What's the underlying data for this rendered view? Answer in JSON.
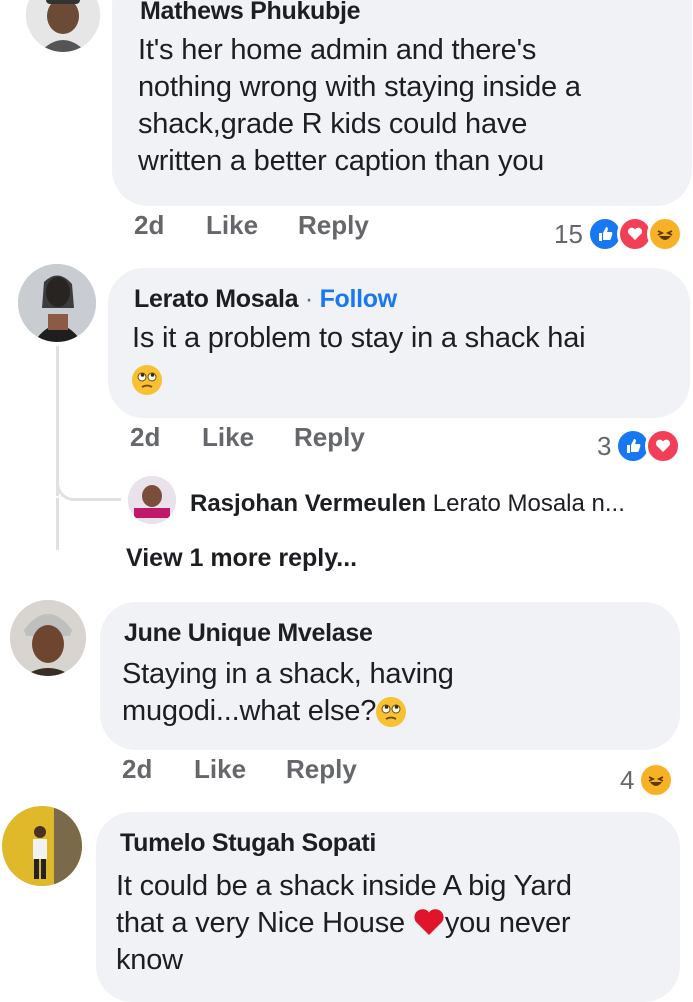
{
  "comments": [
    {
      "author": "Mathews Phukubje",
      "text_lines": [
        "It's her home admin and there's",
        "nothing wrong with staying inside a",
        "shack,grade R kids could have",
        "written a better caption than you"
      ],
      "time": "2d",
      "like": "Like",
      "reply": "Reply",
      "reaction_count": "15",
      "reactions": [
        "like-icon",
        "love-icon",
        "haha-icon"
      ]
    },
    {
      "author": "Lerato Mosala",
      "separator": "·",
      "follow": "Follow",
      "text_lines": [
        "Is it a problem to stay in a shack hai"
      ],
      "emoji_line": "rolling-eyes-emoji",
      "time": "2d",
      "like": "Like",
      "reply": "Reply",
      "reaction_count": "3",
      "reactions": [
        "like-icon",
        "love-icon"
      ]
    },
    {
      "author": "June Unique Mvelase",
      "text_lines": [
        "Staying in a shack, having",
        "mugodi...what else?"
      ],
      "time": "2d",
      "like": "Like",
      "reply": "Reply",
      "reaction_count": "4",
      "reactions": [
        "haha-icon"
      ]
    },
    {
      "author": "Tumelo Stugah Sopati",
      "text_lines": [
        "It could be a shack inside A big Yard",
        "that a very Nice House",
        "you never",
        "know"
      ]
    }
  ],
  "reply_preview": {
    "author": "Rasjohan Vermeulen",
    "snippet": "Lerato Mosala n..."
  },
  "view_more": "View 1 more reply...",
  "colors": {
    "bubble": "#f0f2f5",
    "follow_blue": "#1877f2",
    "meta_gray": "#65676b"
  }
}
